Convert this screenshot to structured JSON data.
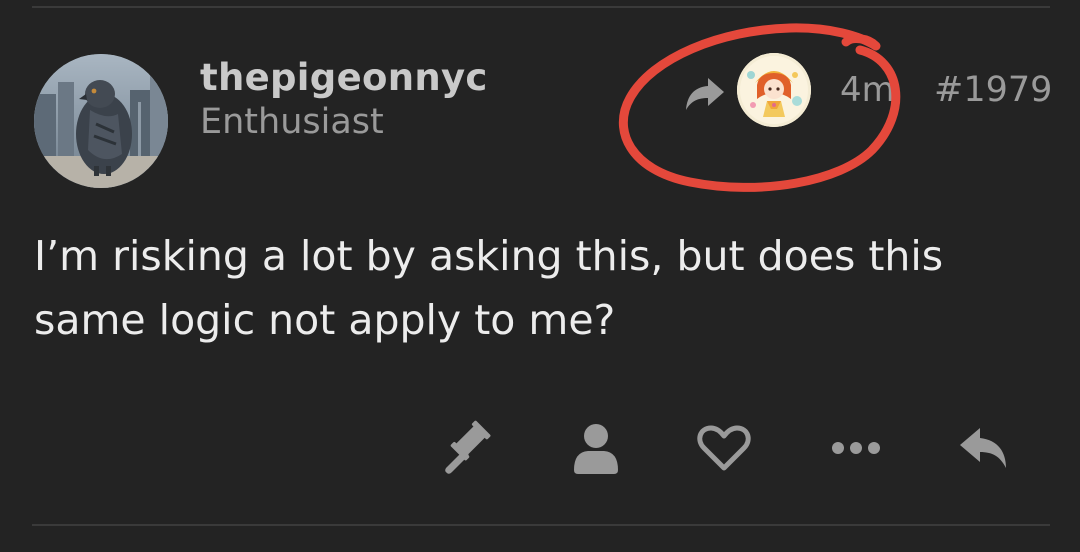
{
  "post": {
    "author": {
      "username": "thepigeonnyc",
      "title": "Enthusiast",
      "avatar_icon": "pigeon-photo-avatar"
    },
    "reply_to": {
      "icon": "reply-arrow-icon",
      "avatar_icon": "anime-character-avatar"
    },
    "time": "4m",
    "number": "#1979",
    "body": "I’m risking a lot by asking this, but does this same logic not apply to me?"
  },
  "actions": [
    {
      "icon": "gavel-icon"
    },
    {
      "icon": "user-icon"
    },
    {
      "icon": "heart-icon"
    },
    {
      "icon": "more-icon"
    },
    {
      "icon": "reply-icon"
    }
  ],
  "colors": {
    "background": "#232323",
    "text_primary": "#ececec",
    "text_muted": "#9a9a9a",
    "icon": "#9a9a9a",
    "annotation": "#e4483b"
  }
}
